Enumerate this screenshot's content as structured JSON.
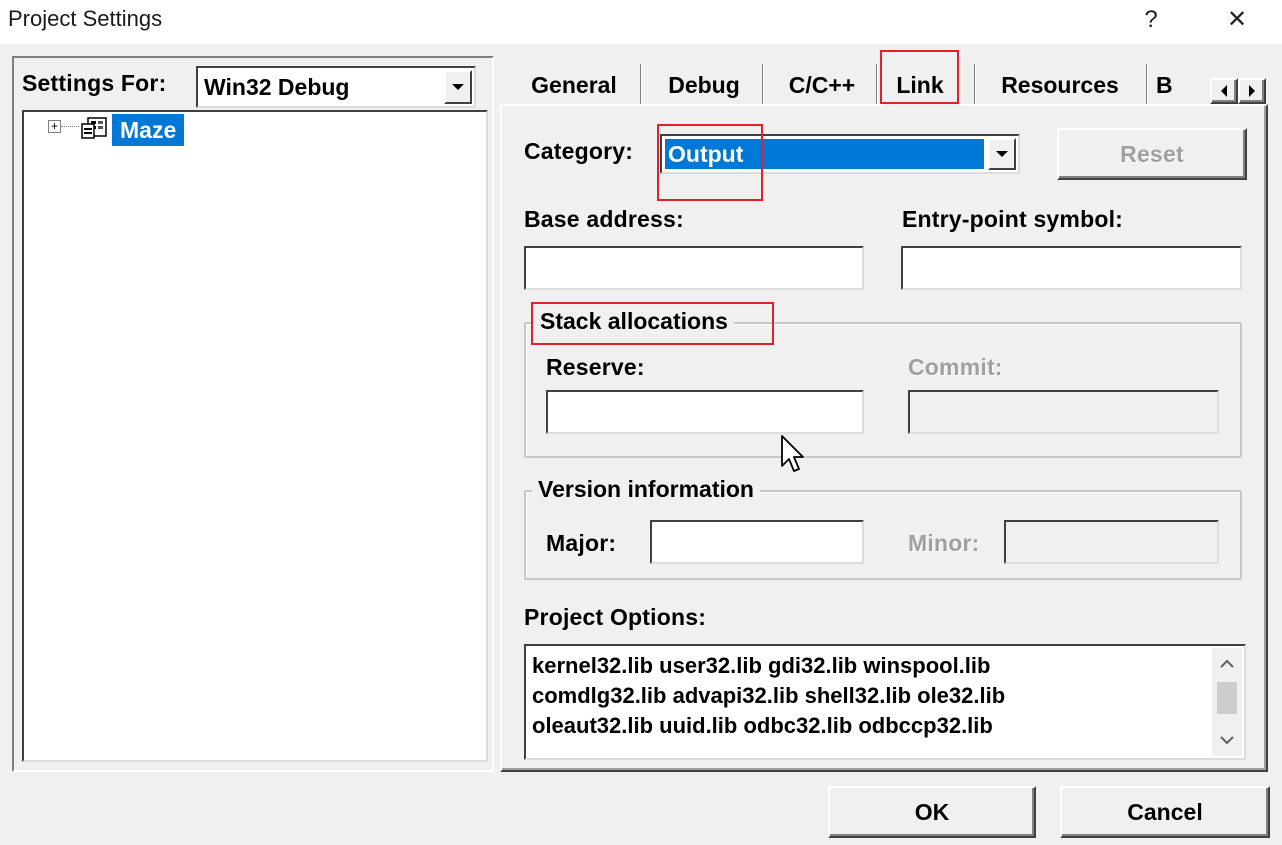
{
  "window": {
    "title": "Project Settings",
    "help_glyph": "?",
    "close_glyph": "✕"
  },
  "left": {
    "settings_for_label": "Settings For:",
    "settings_for_value": "Win32 Debug",
    "tree": {
      "expand_glyph": "+",
      "project_name": "Maze",
      "project_icon": "project-icon"
    }
  },
  "tabs": [
    {
      "label": "General"
    },
    {
      "label": "Debug"
    },
    {
      "label": "C/C++"
    },
    {
      "label": "Link"
    },
    {
      "label": "Resources"
    },
    {
      "label": "B"
    }
  ],
  "link_tab": {
    "category_label": "Category:",
    "category_value": "Output",
    "reset_label": "Reset",
    "base_address_label": "Base address:",
    "entry_point_label": "Entry-point symbol:",
    "base_address_value": "",
    "entry_point_value": "",
    "stack_group_title": "Stack allocations",
    "reserve_label": "Reserve:",
    "commit_label": "Commit:",
    "reserve_value": "",
    "commit_value": "",
    "version_group_title": "Version information",
    "major_label": "Major:",
    "minor_label": "Minor:",
    "major_value": "",
    "minor_value": "",
    "project_options_label": "Project Options:",
    "project_options_lines": [
      "kernel32.lib user32.lib gdi32.lib winspool.lib",
      "comdlg32.lib advapi32.lib shell32.lib ole32.lib",
      "oleaut32.lib uuid.lib odbc32.lib odbccp32.lib"
    ]
  },
  "buttons": {
    "ok": "OK",
    "cancel": "Cancel"
  },
  "colors": {
    "highlight_red": "#e0202a",
    "selection_blue": "#0078d7",
    "dialog_face": "#f0f0f0"
  }
}
